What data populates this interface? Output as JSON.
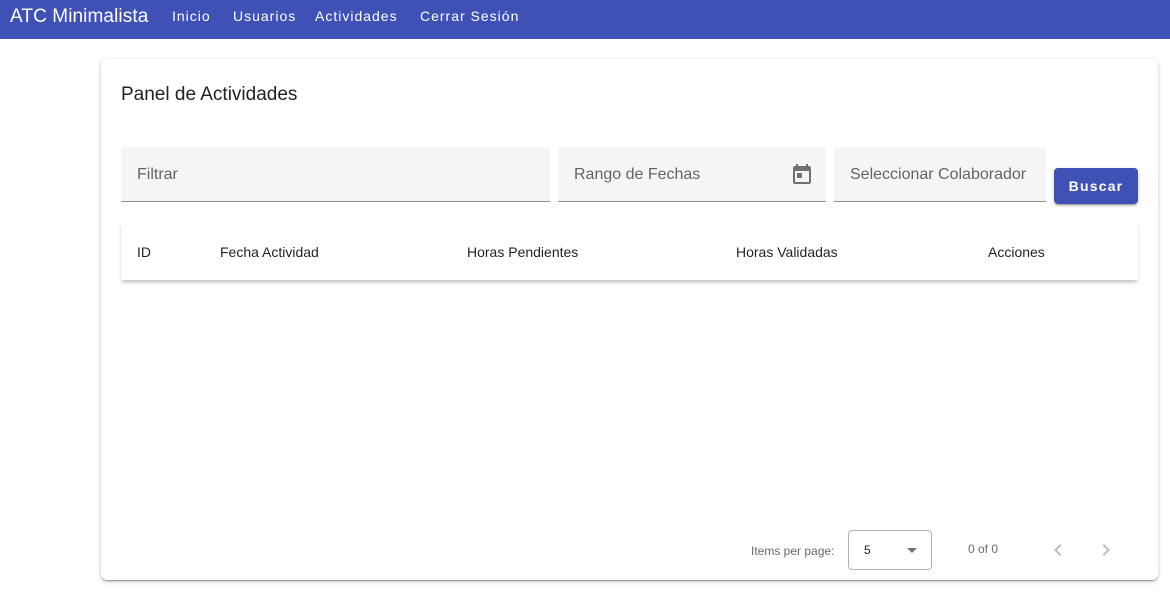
{
  "toolbar": {
    "brand": "ATC Minimalista",
    "nav": [
      "Inicio",
      "Usuarios",
      "Actividades",
      "Cerrar Sesión"
    ],
    "color": "#3f51b5"
  },
  "panel": {
    "title": "Panel de Actividades",
    "filter_label": "Filtrar",
    "date_range_label": "Rango de Fechas",
    "collaborator_label": "Seleccionar Colaborador",
    "search_button": "Buscar"
  },
  "table": {
    "columns": [
      "ID",
      "Fecha Actividad",
      "Horas Pendientes",
      "Horas Validadas",
      "Acciones"
    ],
    "rows": []
  },
  "paginator": {
    "items_per_page_label": "Items per page:",
    "page_size": "5",
    "range_label": "0 of 0"
  },
  "icons": {
    "date_picker": "calendar-icon",
    "prev": "chevron-left-icon",
    "next": "chevron-right-icon",
    "select": "caret-down-icon"
  }
}
